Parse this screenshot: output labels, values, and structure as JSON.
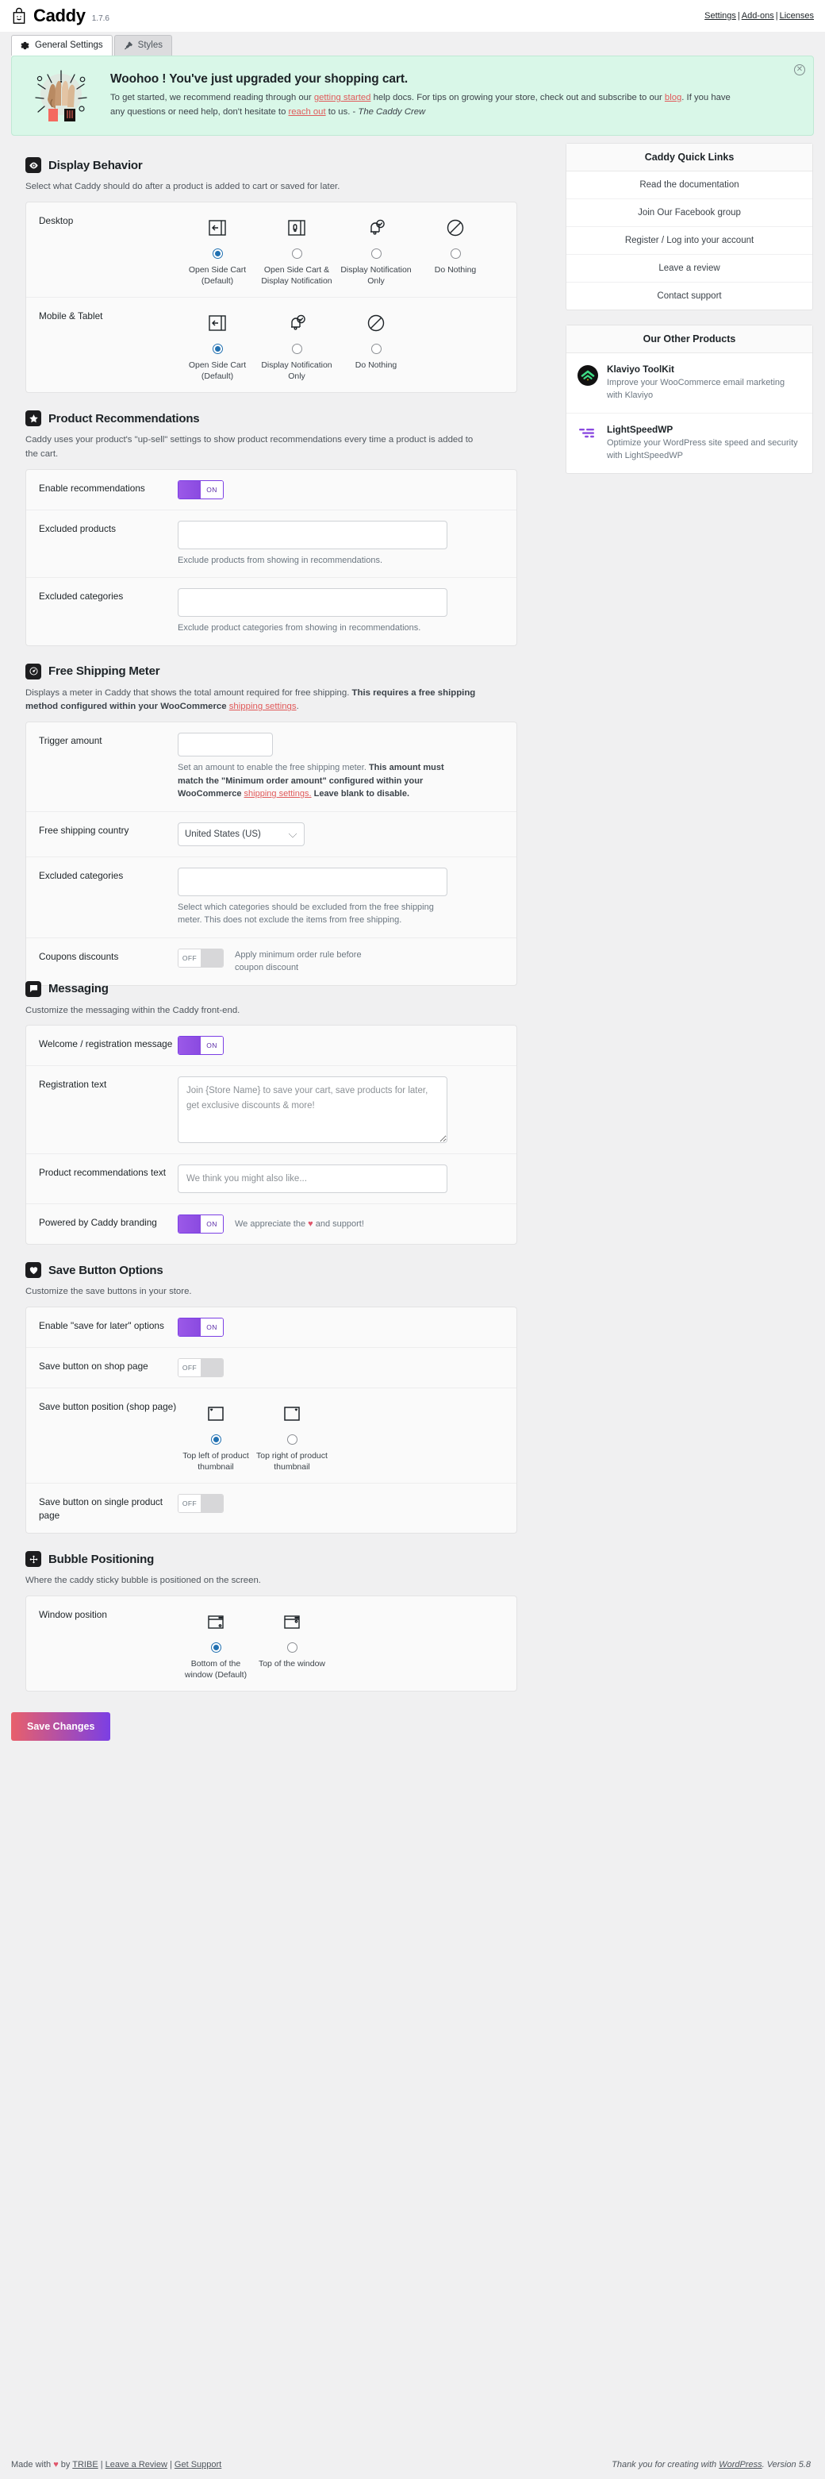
{
  "header": {
    "brand": "Caddy",
    "version": "1.7.6",
    "logo_icon": "shopping-bag-smile-icon",
    "links": [
      {
        "label": "Settings"
      },
      {
        "label": "Add-ons"
      },
      {
        "label": "Licenses"
      }
    ],
    "separator": "|"
  },
  "tabs": [
    {
      "label": "General Settings",
      "icon": "gear-icon",
      "active": true
    },
    {
      "label": "Styles",
      "icon": "brush-icon",
      "active": false
    }
  ],
  "notice": {
    "illustration": "celebrating-hands-icon",
    "title": "Woohoo ! You've just upgraded your shopping cart.",
    "body_1": "To get started, we recommend reading through our ",
    "link_1": "getting started",
    "body_2": " help docs. For tips on growing your store, check out and subscribe to our ",
    "link_2": "blog",
    "body_3": ". If you have any questions or need help, don't hesitate to ",
    "link_3": "reach out",
    "body_4": " to us. - ",
    "signature": "The Caddy Crew",
    "dismiss_icon": "close-icon"
  },
  "sections": {
    "display_behavior": {
      "icon": "eye-icon",
      "title": "Display Behavior",
      "description": "Select what Caddy should do after a product is added to cart or saved for later.",
      "desktop": {
        "label": "Desktop",
        "options": [
          {
            "label": "Open Side Cart (Default)",
            "icon": "side-cart-icon",
            "checked": true
          },
          {
            "label": "Open Side Cart & Display Notification",
            "icon": "side-cart-bell-icon",
            "checked": false
          },
          {
            "label": "Display Notification Only",
            "icon": "bell-check-icon",
            "checked": false
          },
          {
            "label": "Do Nothing",
            "icon": "no-entry-icon",
            "checked": false
          }
        ]
      },
      "mobile": {
        "label": "Mobile & Tablet",
        "options": [
          {
            "label": "Open Side Cart (Default)",
            "icon": "side-cart-icon",
            "checked": true
          },
          {
            "label": "Display Notification Only",
            "icon": "bell-check-icon",
            "checked": false
          },
          {
            "label": "Do Nothing",
            "icon": "no-entry-icon",
            "checked": false
          }
        ]
      }
    },
    "product_recommendations": {
      "icon": "star-icon",
      "title": "Product Recommendations",
      "description": "Caddy uses your product's \"up-sell\" settings to show product recommendations every time a product is added to the cart.",
      "enable": {
        "label": "Enable recommendations",
        "state": "ON"
      },
      "excluded_products": {
        "label": "Excluded products",
        "value": "",
        "help": "Exclude products from showing in recommendations."
      },
      "excluded_categories": {
        "label": "Excluded categories",
        "value": "",
        "help": "Exclude product categories from showing in recommendations."
      }
    },
    "free_shipping_meter": {
      "icon": "gauge-icon",
      "title": "Free Shipping Meter",
      "desc_1": "Displays a meter in Caddy that shows the total amount required for free shipping. ",
      "desc_bold": "This requires a free shipping method configured within your WooCommerce ",
      "desc_link": "shipping settings",
      "desc_2": ".",
      "trigger_amount": {
        "label": "Trigger amount",
        "value": "",
        "help_1": "Set an amount to enable the free shipping meter. ",
        "help_bold_1": "This amount must match the \"Minimum order amount\" configured within your WooCommerce ",
        "help_link": "shipping settings.",
        "help_bold_2": " Leave blank to disable."
      },
      "country": {
        "label": "Free shipping country",
        "value": "United States (US)",
        "options": [
          "United States (US)"
        ]
      },
      "excluded_categories": {
        "label": "Excluded categories",
        "value": "",
        "help": "Select which categories should be excluded from the free shipping meter. This does not exclude the items from free shipping."
      },
      "coupons": {
        "label": "Coupons discounts",
        "state": "OFF",
        "help": "Apply minimum order rule before coupon discount"
      }
    },
    "messaging": {
      "icon": "message-icon",
      "title": "Messaging",
      "description": "Customize the messaging within the Caddy front-end.",
      "welcome": {
        "label": "Welcome / registration message",
        "state": "ON"
      },
      "registration_text": {
        "label": "Registration text",
        "value": "",
        "placeholder": "Join {Store Name} to save your cart, save products for later, get exclusive discounts & more!"
      },
      "recommendations_text": {
        "label": "Product recommendations text",
        "value": "",
        "placeholder": "We think you might also like..."
      },
      "branding": {
        "label": "Powered by Caddy branding",
        "state": "ON",
        "help_1": "We appreciate the ",
        "help_heart": "♥",
        "help_2": " and support!"
      }
    },
    "save_button_options": {
      "icon": "heart-icon",
      "title": "Save Button Options",
      "description": "Customize the save buttons in your store.",
      "enable": {
        "label": "Enable \"save for later\" options",
        "state": "ON"
      },
      "shop_page": {
        "label": "Save button on shop page",
        "state": "OFF"
      },
      "position": {
        "label": "Save button position (shop page)",
        "options": [
          {
            "label": "Top left of product thumbnail",
            "icon": "thumbnail-heart-left-icon",
            "checked": true
          },
          {
            "label": "Top right of product thumbnail",
            "icon": "thumbnail-heart-right-icon",
            "checked": false
          }
        ]
      },
      "single_page": {
        "label": "Save button on single product page",
        "state": "OFF"
      }
    },
    "bubble_positioning": {
      "icon": "move-icon",
      "title": "Bubble Positioning",
      "description": "Where the caddy sticky bubble is positioned on the screen.",
      "window_position": {
        "label": "Window position",
        "options": [
          {
            "label": "Bottom of the window (Default)",
            "icon": "window-bottom-icon",
            "checked": true
          },
          {
            "label": "Top of the window",
            "icon": "window-top-icon",
            "checked": false
          }
        ]
      }
    }
  },
  "sidebar": {
    "quick_links": {
      "title": "Caddy Quick Links",
      "items": [
        {
          "label": "Read the documentation"
        },
        {
          "label": "Join Our Facebook group"
        },
        {
          "label": "Register / Log into your account"
        },
        {
          "label": "Leave a review"
        },
        {
          "label": "Contact support"
        }
      ]
    },
    "other_products": {
      "title": "Our Other Products",
      "items": [
        {
          "name": "Klaviyo ToolKit",
          "description": "Improve your WooCommerce email marketing with Klaviyo",
          "icon": "klaviyo-toolkit-icon"
        },
        {
          "name": "LightSpeedWP",
          "description": "Optimize your WordPress site speed and security with LightSpeedWP",
          "icon": "lightspeedwp-icon"
        }
      ]
    }
  },
  "save_button": {
    "label": "Save Changes"
  },
  "footer": {
    "made_with": "Made with ",
    "heart": "♥",
    "by": " by ",
    "tribe": "TRIBE",
    "sep1": " | ",
    "review": "Leave a Review",
    "sep2": " | ",
    "support": "Get Support",
    "thanks": "Thank you for creating with ",
    "wordpress": "WordPress",
    "version": ". Version 5.8"
  },
  "colors": {
    "accent_purple": "#7b3fe4",
    "accent_pink": "#e8606b",
    "notice_bg": "#d9f7e8",
    "link_red": "#e05a5a",
    "radio_blue": "#2271b1"
  }
}
